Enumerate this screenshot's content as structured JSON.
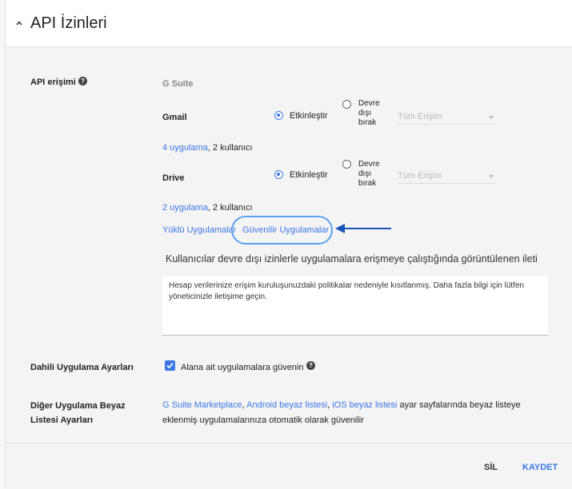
{
  "header": {
    "title": "API İzinleri"
  },
  "api_access": {
    "label": "API erişimi",
    "suite": "G Suite",
    "gmail": {
      "name": "Gmail",
      "enable_label": "Etkinleştir",
      "disable_line1": "Devre",
      "disable_line2": "dışı",
      "disable_line3": "bırak",
      "select_value": "Tüm Erişim",
      "apps_link": "4 uygulama",
      "users_text": ", 2 kullanıcı"
    },
    "drive": {
      "name": "Drive",
      "enable_label": "Etkinleştir",
      "disable_line1": "Devre",
      "disable_line2": "dışı",
      "disable_line3": "bırak",
      "select_value": "Tüm Erişim",
      "apps_link": "2 uygulama",
      "users_text": ", 2 kullanıcı"
    },
    "installed_apps_link": "Yüklü Uygulamalar",
    "trusted_apps_link": "Güvenilir Uygulamalar",
    "message_heading": "Kullanıcılar devre dışı izinlerle uygulamalara erişmeye çalıştığında görüntülenen ileti",
    "message_text": "Hesap verilerinize erişim kuruluşunuzdaki politikalar nedeniyle kısıtlanmış. Daha fazla bilgi için lütfen yöneticinizle iletişime geçin."
  },
  "internal_apps": {
    "label": "Dahili Uygulama Ayarları",
    "checkbox_label": "Alana ait uygulamalara güvenin"
  },
  "whitelist": {
    "label_line1": "Diğer Uygulama Beyaz",
    "label_line2": "Listesi Ayarları",
    "link1": "G Suite Marketplace",
    "sep1": ", ",
    "link2": "Android beyaz listesi",
    "sep2": ", ",
    "link3": "iOS beyaz listesi",
    "rest_line1": " ayar sayfalarında beyaz listeye",
    "line2": "eklenmiş uygulamalarınıza otomatik olarak güvenilir"
  },
  "footer": {
    "delete_label": "SİL",
    "save_label": "KAYDET"
  },
  "colors": {
    "accent": "#3b78e7",
    "highlight": "#5b9ff0",
    "arrow": "#1a56b8"
  }
}
